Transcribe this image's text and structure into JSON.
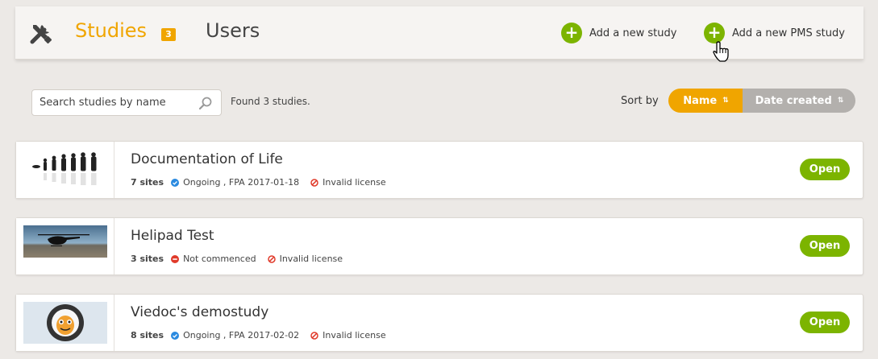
{
  "header": {
    "tabs": {
      "studies": {
        "label": "Studies",
        "badge": "3"
      },
      "users": {
        "label": "Users"
      }
    },
    "actions": {
      "add_study": "Add a new study",
      "add_pms_study": "Add a new PMS study"
    }
  },
  "toolbar": {
    "search_placeholder": "Search studies by name",
    "found_text": "Found 3 studies.",
    "sort_label": "Sort by",
    "sort_name": "Name",
    "sort_date": "Date created"
  },
  "studies": [
    {
      "title": "Documentation of Life",
      "sites": "7 sites",
      "status": "Ongoing , FPA 2017-01-18",
      "status_icon": "check-circle-icon",
      "license": "Invalid license",
      "open": "Open"
    },
    {
      "title": "Helipad Test",
      "sites": "3 sites",
      "status": "Not commenced",
      "status_icon": "minus-circle-icon",
      "license": "Invalid license",
      "open": "Open"
    },
    {
      "title": "Viedoc's demostudy",
      "sites": "8 sites",
      "status": "Ongoing , FPA 2017-02-02",
      "status_icon": "check-circle-icon",
      "license": "Invalid license",
      "open": "Open"
    }
  ],
  "colors": {
    "accent": "#f0a500",
    "green": "#7cb400",
    "ongoing": "#2a8ae0",
    "not_commenced": "#e03a2a",
    "invalid": "#e03a2a"
  }
}
